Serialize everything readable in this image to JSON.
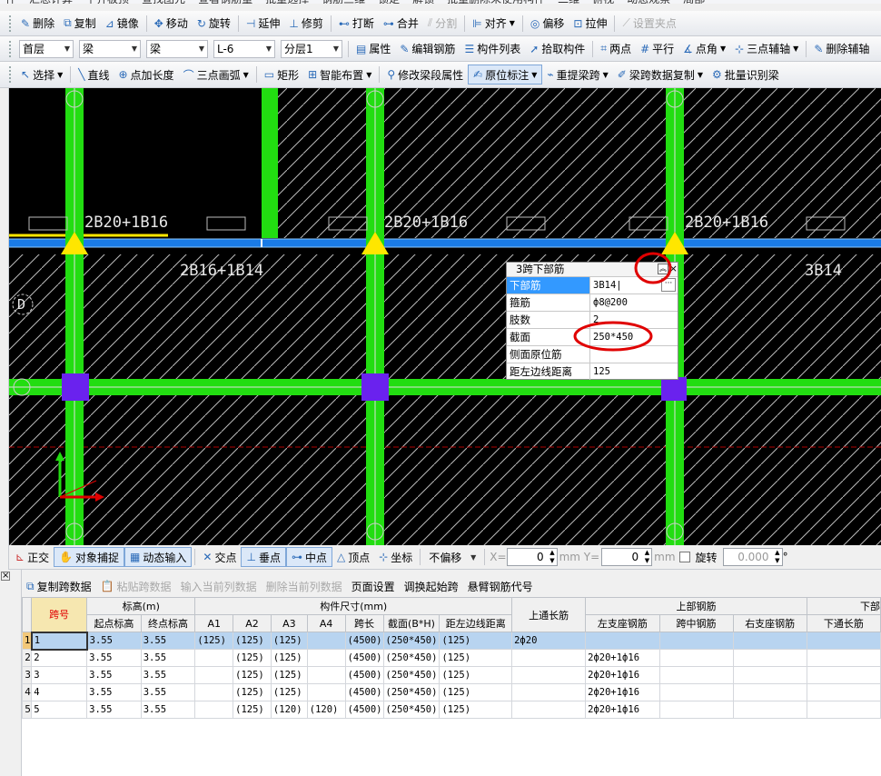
{
  "menu_row": {
    "items": [
      "件",
      "汇总计算",
      "平齐板顶",
      "查找图元",
      "查看钢筋量",
      "批量选择",
      "钢筋三维",
      "锁定",
      "解锁",
      "批量删除未使用构件",
      "二维",
      "俯视",
      "动态观察",
      "局部"
    ]
  },
  "toolbar1": {
    "items": [
      {
        "icon": "delete-icon",
        "label": "删除",
        "glyph": "✎",
        "disabled": false
      },
      {
        "icon": "copy-icon",
        "label": "复制",
        "glyph": "⧉",
        "disabled": false
      },
      {
        "icon": "mirror-icon",
        "label": "镜像",
        "glyph": "⊿",
        "disabled": false
      },
      {
        "icon": "move-icon",
        "label": "移动",
        "glyph": "✥",
        "disabled": false
      },
      {
        "icon": "rotate-icon",
        "label": "旋转",
        "glyph": "↻",
        "disabled": false
      },
      {
        "icon": "extend-icon",
        "label": "延伸",
        "glyph": "⊣",
        "disabled": false
      },
      {
        "icon": "trim-icon",
        "label": "修剪",
        "glyph": "⊥",
        "disabled": false
      },
      {
        "icon": "break-icon",
        "label": "打断",
        "glyph": "⊷",
        "disabled": false
      },
      {
        "icon": "merge-icon",
        "label": "合并",
        "glyph": "⊶",
        "disabled": false
      },
      {
        "icon": "split-icon",
        "label": "分割",
        "glyph": "⫽",
        "disabled": true
      },
      {
        "icon": "align-icon",
        "label": "对齐",
        "glyph": "⊫",
        "disabled": false,
        "dropdown": true
      },
      {
        "icon": "offset-icon",
        "label": "偏移",
        "glyph": "◎",
        "disabled": false
      },
      {
        "icon": "stretch-icon",
        "label": "拉伸",
        "glyph": "⊡",
        "disabled": false
      },
      {
        "icon": "grip-icon",
        "label": "设置夹点",
        "glyph": "⟋",
        "disabled": true
      }
    ]
  },
  "toolbar2": {
    "selects": [
      {
        "value": "首层"
      },
      {
        "value": "梁"
      },
      {
        "value": "梁"
      },
      {
        "value": "L-6"
      },
      {
        "value": "分层1"
      }
    ],
    "items": [
      {
        "icon": "property-icon",
        "label": "属性",
        "glyph": "▤"
      },
      {
        "icon": "edit-rebar-icon",
        "label": "编辑钢筋",
        "glyph": "✎"
      },
      {
        "icon": "component-list-icon",
        "label": "构件列表",
        "glyph": "☰"
      },
      {
        "icon": "pick-component-icon",
        "label": "拾取构件",
        "glyph": "➚"
      },
      {
        "icon": "two-point-icon",
        "label": "两点",
        "glyph": "⌗"
      },
      {
        "icon": "parallel-icon",
        "label": "平行",
        "glyph": "#"
      },
      {
        "icon": "point-angle-icon",
        "label": "点角",
        "glyph": "∡",
        "dropdown": true
      },
      {
        "icon": "three-point-aux-icon",
        "label": "三点辅轴",
        "glyph": "⊹",
        "dropdown": true
      },
      {
        "icon": "delete-aux-icon",
        "label": "删除辅轴",
        "glyph": "✎"
      }
    ]
  },
  "toolbar3": {
    "items": [
      {
        "icon": "select-icon",
        "label": "选择",
        "glyph": "↖",
        "dropdown": true
      },
      {
        "icon": "line-icon",
        "label": "直线",
        "glyph": "╲"
      },
      {
        "icon": "point-length-icon",
        "label": "点加长度",
        "glyph": "⊕"
      },
      {
        "icon": "three-point-arc-icon",
        "label": "三点画弧",
        "glyph": "⌒",
        "dropdown": true
      },
      {
        "icon": "rectangle-icon",
        "label": "矩形",
        "glyph": "▭"
      },
      {
        "icon": "smart-layout-icon",
        "label": "智能布置",
        "glyph": "⊞",
        "dropdown": true
      },
      {
        "icon": "modify-span-icon",
        "label": "修改梁段属性",
        "glyph": "⚲"
      },
      {
        "icon": "original-annotation-icon",
        "label": "原位标注",
        "glyph": "✍",
        "active": true,
        "dropdown": true
      },
      {
        "icon": "re-extract-span-icon",
        "label": "重提梁跨",
        "glyph": "⌁",
        "dropdown": true
      },
      {
        "icon": "span-data-copy-icon",
        "label": "梁跨数据复制",
        "glyph": "✐",
        "dropdown": true
      },
      {
        "icon": "batch-identify-icon",
        "label": "批量识别梁",
        "glyph": "⚙"
      }
    ]
  },
  "canvas": {
    "top_labels": [
      "2B20+1B16",
      "2B20+1B16",
      "2B20+1B16"
    ],
    "bottom_labels": [
      "2B16+1B14",
      "3B14"
    ],
    "axis_label": "D"
  },
  "prop_panel": {
    "title": "3跨下部筋",
    "rows": [
      {
        "key": "下部筋",
        "value": "3B14|",
        "selected": true
      },
      {
        "key": "箍筋",
        "value": "ф8@200"
      },
      {
        "key": "肢数",
        "value": "2"
      },
      {
        "key": "截面",
        "value": "250*450"
      },
      {
        "key": "侧面原位筋",
        "value": ""
      },
      {
        "key": "距左边线距离",
        "value": "125"
      }
    ]
  },
  "statusbar": {
    "ortho": "正交",
    "snap": "对象捕捉",
    "dynamic_input": "动态输入",
    "intersection": "交点",
    "perpendicular": "垂点",
    "midpoint": "中点",
    "vertex": "顶点",
    "coordinate": "坐标",
    "offset_mode": "不偏移",
    "x_label": "X=",
    "x_value": "0",
    "y_label": "mm Y=",
    "y_value": "0",
    "mm": "mm",
    "rotate_label": "旋转",
    "rotate_value": "0.000",
    "degree": "°"
  },
  "table_toolbar": {
    "items": [
      {
        "label": "复制跨数据",
        "disabled": false
      },
      {
        "label": "粘贴跨数据",
        "disabled": true
      },
      {
        "label": "输入当前列数据",
        "disabled": true
      },
      {
        "label": "删除当前列数据",
        "disabled": true
      },
      {
        "label": "页面设置",
        "disabled": false
      },
      {
        "label": "调换起始跨",
        "disabled": false
      },
      {
        "label": "悬臂钢筋代号",
        "disabled": false
      }
    ]
  },
  "table": {
    "group_headers": {
      "span_no": "跨号",
      "elevation": "标高(m)",
      "dims": "构件尺寸(mm)",
      "top_through": "上通长筋",
      "top_rebar": "上部钢筋",
      "bottom": "下部"
    },
    "sub_headers": [
      "起点标高",
      "终点标高",
      "A1",
      "A2",
      "A3",
      "A4",
      "跨长",
      "截面(B*H)",
      "距左边线距离",
      "左支座钢筋",
      "跨中钢筋",
      "右支座钢筋",
      "下通长筋"
    ],
    "rows": [
      [
        "1",
        "1",
        "3.55",
        "3.55",
        "(125)",
        "(125)",
        "(125)",
        "",
        "(4500)",
        "(250*450)",
        "(125)",
        "2ф20",
        "",
        "",
        "",
        ""
      ],
      [
        "2",
        "2",
        "3.55",
        "3.55",
        "",
        "(125)",
        "(125)",
        "",
        "(4500)",
        "(250*450)",
        "(125)",
        "",
        "2ф20+1ф16",
        "",
        "",
        ""
      ],
      [
        "3",
        "3",
        "3.55",
        "3.55",
        "",
        "(125)",
        "(125)",
        "",
        "(4500)",
        "(250*450)",
        "(125)",
        "",
        "2ф20+1ф16",
        "",
        "",
        ""
      ],
      [
        "4",
        "4",
        "3.55",
        "3.55",
        "",
        "(125)",
        "(125)",
        "",
        "(4500)",
        "(250*450)",
        "(125)",
        "",
        "2ф20+1ф16",
        "",
        "",
        ""
      ],
      [
        "5",
        "5",
        "3.55",
        "3.55",
        "",
        "(125)",
        "(120)",
        "(120)",
        "(4500)",
        "(250*450)",
        "(125)",
        "",
        "2ф20+1ф16",
        "",
        "",
        ""
      ]
    ]
  },
  "colors": {
    "beam_green": "#22dd11",
    "beam_blue": "#1a7be6",
    "column_purple": "#6a22ee",
    "anchor_yellow": "#ffe600",
    "annotation_red": "#e00000",
    "selection_blue": "#3399ff"
  }
}
